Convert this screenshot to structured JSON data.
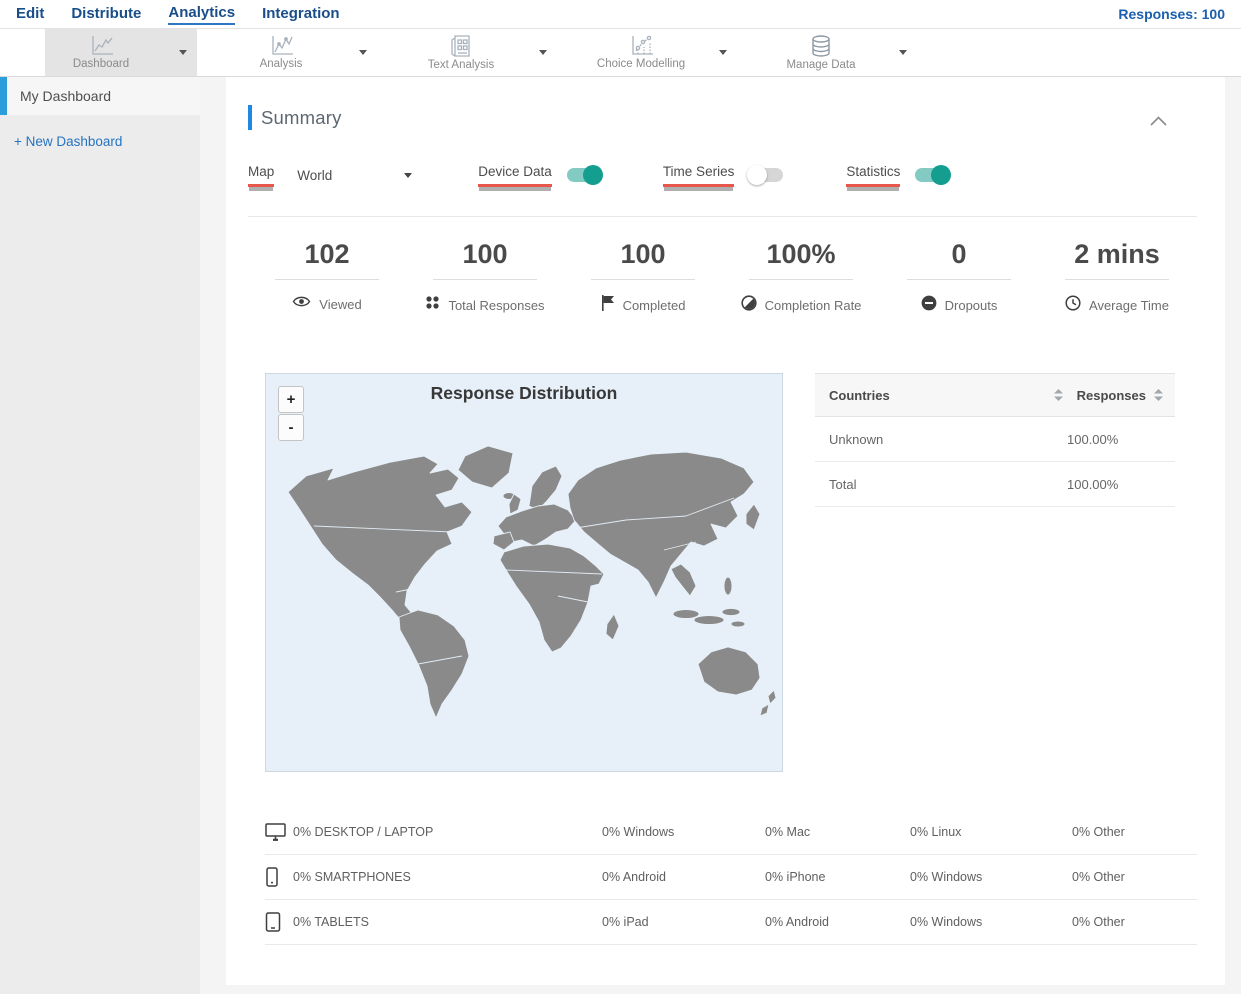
{
  "nav": {
    "items": [
      {
        "label": "Edit",
        "active": false
      },
      {
        "label": "Distribute",
        "active": false
      },
      {
        "label": "Analytics",
        "active": true
      },
      {
        "label": "Integration",
        "active": false
      }
    ],
    "responses_label": "Responses: 100"
  },
  "toolbar": {
    "items": [
      {
        "label": "Dashboard",
        "icon": "line-chart-icon",
        "selected": true
      },
      {
        "label": "Analysis",
        "icon": "trend-chart-icon",
        "selected": false
      },
      {
        "label": "Text Analysis",
        "icon": "document-grid-icon",
        "selected": false
      },
      {
        "label": "Choice Modelling",
        "icon": "scatter-chart-icon",
        "selected": false
      },
      {
        "label": "Manage Data",
        "icon": "database-icon",
        "selected": false
      }
    ]
  },
  "sidebar": {
    "items": [
      {
        "label": "My Dashboard",
        "active": true
      }
    ],
    "new_dashboard_label": "+ New Dashboard"
  },
  "summary": {
    "title": "Summary",
    "controls": {
      "map": {
        "label": "Map",
        "value": "World"
      },
      "device_data": {
        "label": "Device Data",
        "state": "on"
      },
      "time_series": {
        "label": "Time Series",
        "state": "off"
      },
      "statistics": {
        "label": "Statistics",
        "state": "on"
      }
    }
  },
  "stats": [
    {
      "value": "102",
      "label": "Viewed",
      "icon": "eye-icon"
    },
    {
      "value": "100",
      "label": "Total Responses",
      "icon": "dots-grid-icon"
    },
    {
      "value": "100",
      "label": "Completed",
      "icon": "flag-icon"
    },
    {
      "value": "100%",
      "label": "Completion Rate",
      "icon": "half-circle-icon"
    },
    {
      "value": "0",
      "label": "Dropouts",
      "icon": "minus-circle-icon"
    },
    {
      "value": "2 mins",
      "label": "Average Time",
      "icon": "clock-icon"
    }
  ],
  "map": {
    "title": "Response Distribution",
    "zoom_in": "+",
    "zoom_out": "-"
  },
  "countries_table": {
    "headers": {
      "col1": "Countries",
      "col2": "Responses"
    },
    "rows": [
      {
        "country": "Unknown",
        "responses": "100.00%"
      },
      {
        "country": "Total",
        "responses": "100.00%"
      }
    ]
  },
  "device_table": {
    "rows": [
      {
        "icon": "desktop-icon",
        "name": "0% DESKTOP / LAPTOP",
        "c1": "0% Windows",
        "c2": "0% Mac",
        "c3": "0% Linux",
        "c4": "0% Other"
      },
      {
        "icon": "smartphone-icon",
        "name": "0% SMARTPHONES",
        "c1": "0% Android",
        "c2": "0% iPhone",
        "c3": "0% Windows",
        "c4": "0% Other"
      },
      {
        "icon": "tablet-icon",
        "name": "0% TABLETS",
        "c1": "0% iPad",
        "c2": "0% Android",
        "c3": "0% Windows",
        "c4": "0% Other"
      }
    ]
  },
  "colors": {
    "nav_blue": "#1a4e8a",
    "accent_blue": "#1e88e5",
    "sidebar_active_blue": "#2d9cdb",
    "toggle_teal": "#149e90",
    "highlight_red": "#e8574b",
    "map_land": "#8a8a8a",
    "map_bg": "#e7f0f8"
  }
}
